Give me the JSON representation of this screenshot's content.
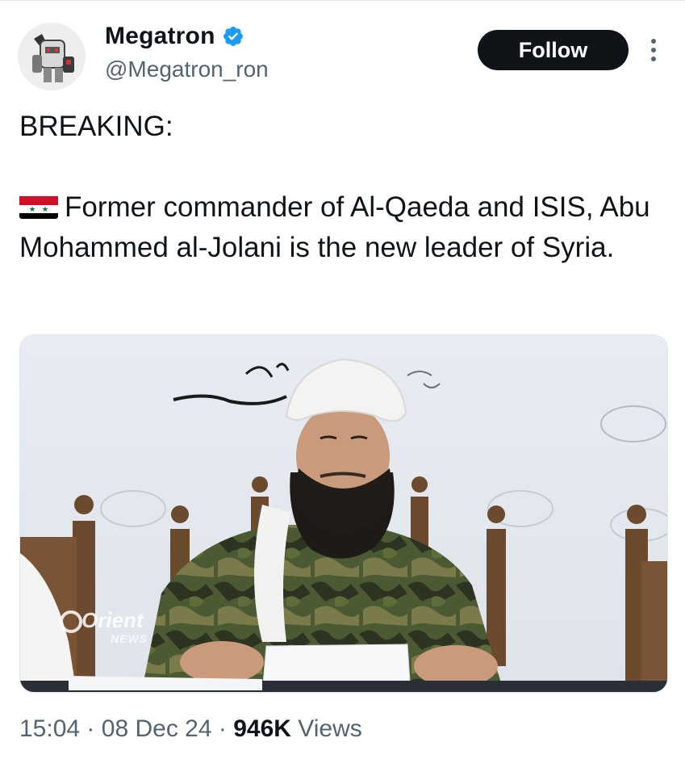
{
  "tweet": {
    "author": {
      "display_name": "Megatron",
      "handle": "@Megatron_ron",
      "verified_icon": "verified-badge-icon",
      "avatar_icon": "robot-avatar"
    },
    "follow_label": "Follow",
    "more_icon": "more-vertical-icon",
    "text_line1": "BREAKING:",
    "flag_icon": "syria-flag-icon",
    "text_body": "Former commander of Al-Qaeda and ISIS, Abu Mohammed al-Jolani is the new leader of Syria.",
    "media": {
      "watermark_line1": "Orient",
      "watermark_line2": "NEWS"
    },
    "time": "15:04",
    "separator": "·",
    "date": "08 Dec 24",
    "views_count": "946K",
    "views_label": "Views"
  },
  "colors": {
    "text_primary": "#0f1419",
    "text_secondary": "#536471",
    "verified_blue": "#1d9bf0",
    "follow_bg": "#0f1419"
  }
}
